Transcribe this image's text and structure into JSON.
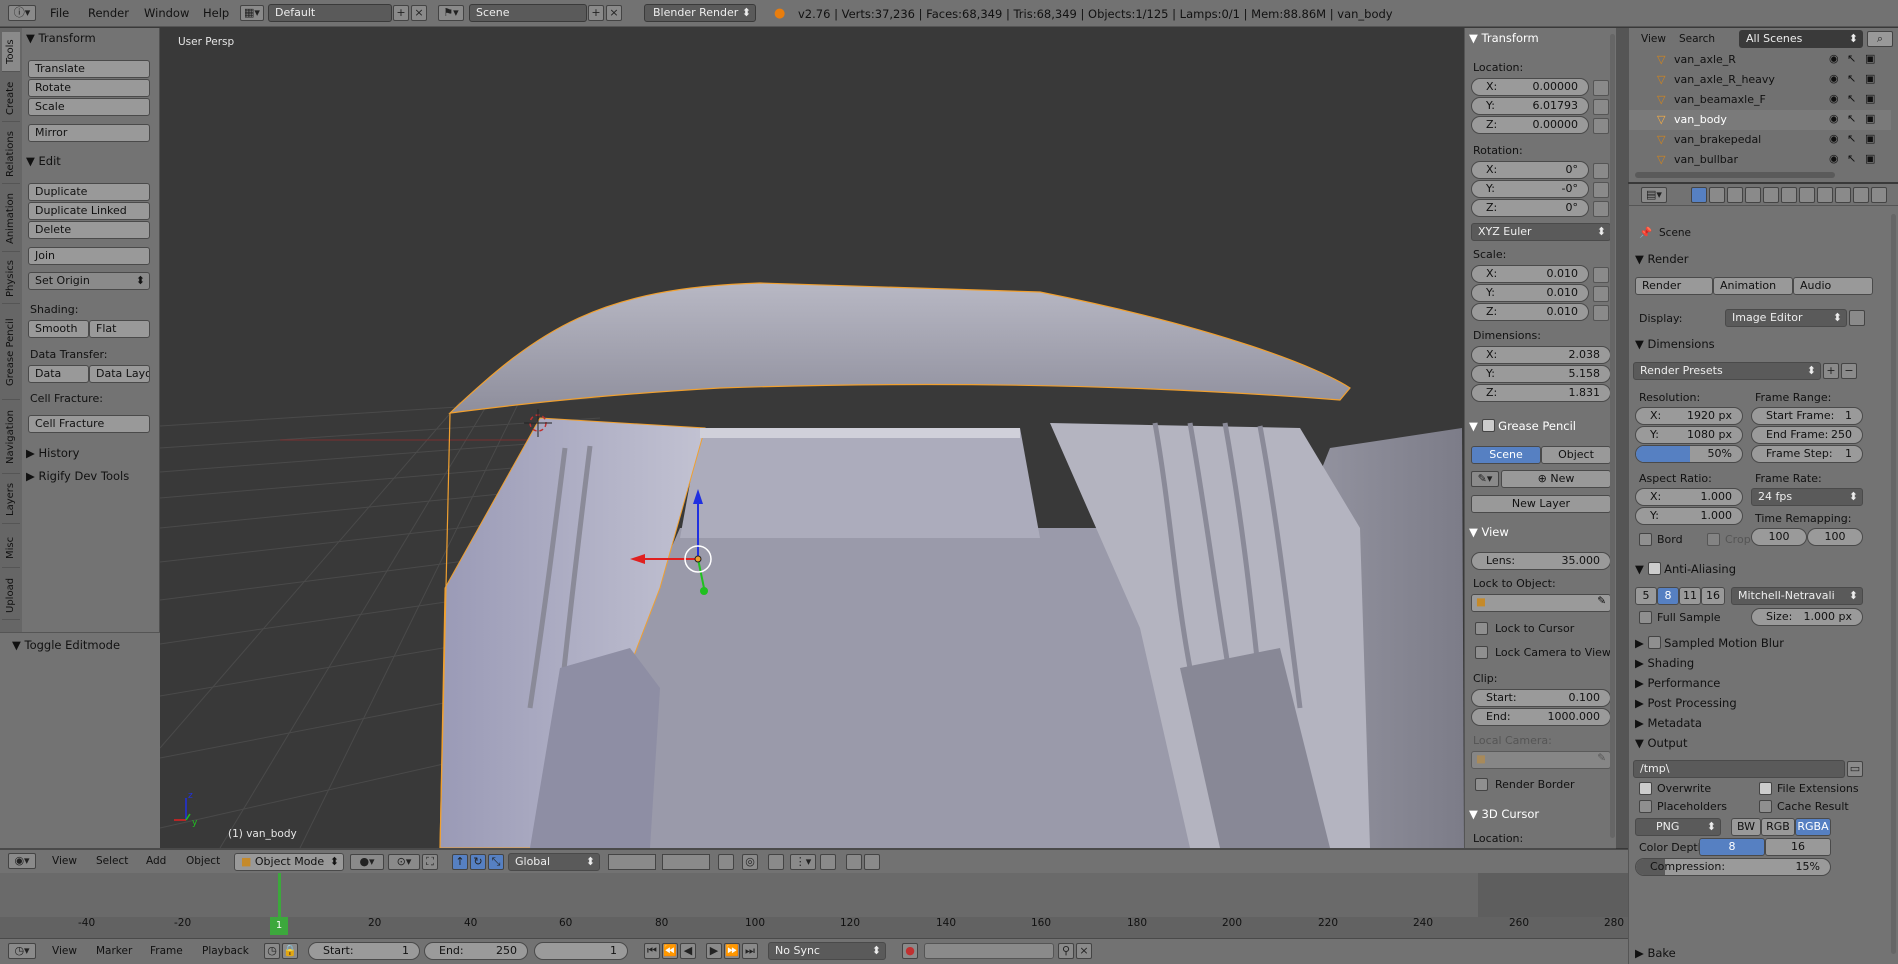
{
  "topbar": {
    "menus": [
      "File",
      "Render",
      "Window",
      "Help"
    ],
    "layout": "Default",
    "scene": "Scene",
    "engine": "Blender Render",
    "stats": "v2.76 | Verts:37,236 | Faces:68,349 | Tris:68,349 | Objects:1/125 | Lamps:0/1 | Mem:88.86M | van_body"
  },
  "tabs": [
    "Tools",
    "Create",
    "Relations",
    "Animation",
    "Physics",
    "Grease Pencil",
    "Navigation",
    "Layers",
    "Misc",
    "Upload"
  ],
  "toolshelf": {
    "transform_title": "Transform",
    "translate": "Translate",
    "rotate": "Rotate",
    "scale": "Scale",
    "mirror": "Mirror",
    "edit_title": "Edit",
    "duplicate": "Duplicate",
    "duplicate_linked": "Duplicate Linked",
    "delete": "Delete",
    "join": "Join",
    "set_origin": "Set Origin",
    "shading": "Shading:",
    "smooth": "Smooth",
    "flat": "Flat",
    "data_transfer": "Data Transfer:",
    "data": "Data",
    "data_layo": "Data Layo",
    "cell_fracture_lbl": "Cell Fracture:",
    "cell_fracture": "Cell Fracture",
    "history": "History",
    "rigify": "Rigify Dev Tools",
    "toggle_editmode": "Toggle Editmode"
  },
  "viewport": {
    "view_label": "User Persp",
    "object_label": "(1) van_body"
  },
  "npanel": {
    "transform_title": "Transform",
    "location": "Location:",
    "loc": [
      {
        "k": "X:",
        "v": "0.00000"
      },
      {
        "k": "Y:",
        "v": "6.01793"
      },
      {
        "k": "Z:",
        "v": "0.00000"
      }
    ],
    "rotation": "Rotation:",
    "rot": [
      {
        "k": "X:",
        "v": "0°"
      },
      {
        "k": "Y:",
        "v": "-0°"
      },
      {
        "k": "Z:",
        "v": "0°"
      }
    ],
    "rot_mode": "XYZ Euler",
    "scale": "Scale:",
    "scl": [
      {
        "k": "X:",
        "v": "0.010"
      },
      {
        "k": "Y:",
        "v": "0.010"
      },
      {
        "k": "Z:",
        "v": "0.010"
      }
    ],
    "dimensions": "Dimensions:",
    "dim": [
      {
        "k": "X:",
        "v": "2.038"
      },
      {
        "k": "Y:",
        "v": "5.158"
      },
      {
        "k": "Z:",
        "v": "1.831"
      }
    ],
    "grease_title": "Grease Pencil",
    "gp_scene": "Scene",
    "gp_object": "Object",
    "gp_new": "New",
    "gp_new_layer": "New Layer",
    "view_title": "View",
    "lens_k": "Lens:",
    "lens_v": "35.000",
    "lock_to_object": "Lock to Object:",
    "lock_to_cursor": "Lock to Cursor",
    "lock_camera": "Lock Camera to View",
    "clip": "Clip:",
    "clip_start_k": "Start:",
    "clip_start_v": "0.100",
    "clip_end_k": "End:",
    "clip_end_v": "1000.000",
    "local_camera": "Local Camera:",
    "render_border": "Render Border",
    "cursor_title": "3D Cursor",
    "cursor_location": "Location:"
  },
  "outliner": {
    "view": "View",
    "search": "Search",
    "scenes": "All Scenes",
    "items": [
      "van_axle_R",
      "van_axle_R_heavy",
      "van_beamaxle_F",
      "van_body",
      "van_brakepedal",
      "van_bullbar"
    ]
  },
  "props": {
    "scene": "Scene",
    "render_title": "Render",
    "render_btn": "Render",
    "animation_btn": "Animation",
    "audio_btn": "Audio",
    "display_k": "Display:",
    "display_v": "Image Editor",
    "dimensions_title": "Dimensions",
    "presets": "Render Presets",
    "resolution": "Resolution:",
    "res_x_k": "X:",
    "res_x_v": "1920 px",
    "res_y_k": "Y:",
    "res_y_v": "1080 px",
    "res_pct": "50%",
    "frame_range": "Frame Range:",
    "start_frame_k": "Start Frame:",
    "start_frame_v": "1",
    "end_frame_k": "End Frame:",
    "end_frame_v": "250",
    "frame_step_k": "Frame Step:",
    "frame_step_v": "1",
    "aspect": "Aspect Ratio:",
    "asp_x_k": "X:",
    "asp_x_v": "1.000",
    "asp_y_k": "Y:",
    "asp_y_v": "1.000",
    "frame_rate": "Frame Rate:",
    "fps": "24 fps",
    "time_remap": "Time Remapping:",
    "remap_old": "100",
    "remap_new": "100",
    "bord": "Bord",
    "crop": "Crop",
    "aa_title": "Anti-Aliasing",
    "aa_samples": [
      "5",
      "8",
      "11",
      "16"
    ],
    "aa_filter": "Mitchell-Netravali",
    "full_sample": "Full Sample",
    "size_k": "Size:",
    "size_v": "1.000 px",
    "motion_blur": "Sampled Motion Blur",
    "shading": "Shading",
    "performance": "Performance",
    "post_processing": "Post Processing",
    "metadata": "Metadata",
    "output": "Output",
    "output_path": "/tmp\\",
    "overwrite": "Overwrite",
    "file_ext": "File Extensions",
    "placeholders": "Placeholders",
    "cache_result": "Cache Result",
    "format": "PNG",
    "bw": "BW",
    "rgb": "RGB",
    "rgba": "RGBA",
    "color_depth": "Color Depth:",
    "depth8": "8",
    "depth16": "16",
    "compression_k": "Compression:",
    "compression_v": "15%",
    "bake": "Bake"
  },
  "view3d_header": {
    "view": "View",
    "select": "Select",
    "add": "Add",
    "object": "Object",
    "mode": "Object Mode",
    "orientation": "Global"
  },
  "timeline": {
    "ticks": [
      "-40",
      "-20",
      "0",
      "20",
      "40",
      "60",
      "80",
      "100",
      "120",
      "140",
      "160",
      "180",
      "200",
      "220",
      "240",
      "260",
      "280"
    ],
    "current_frame": "1",
    "menus": [
      "View",
      "Marker",
      "Frame",
      "Playback"
    ],
    "start_k": "Start:",
    "start_v": "1",
    "end_k": "End:",
    "end_v": "250",
    "sync": "No Sync"
  },
  "colors": {
    "accent": "#5680c2",
    "selection_outline": "#f0a030",
    "axis_x": "#e02020",
    "axis_y": "#20c020",
    "axis_z": "#2030e0"
  }
}
